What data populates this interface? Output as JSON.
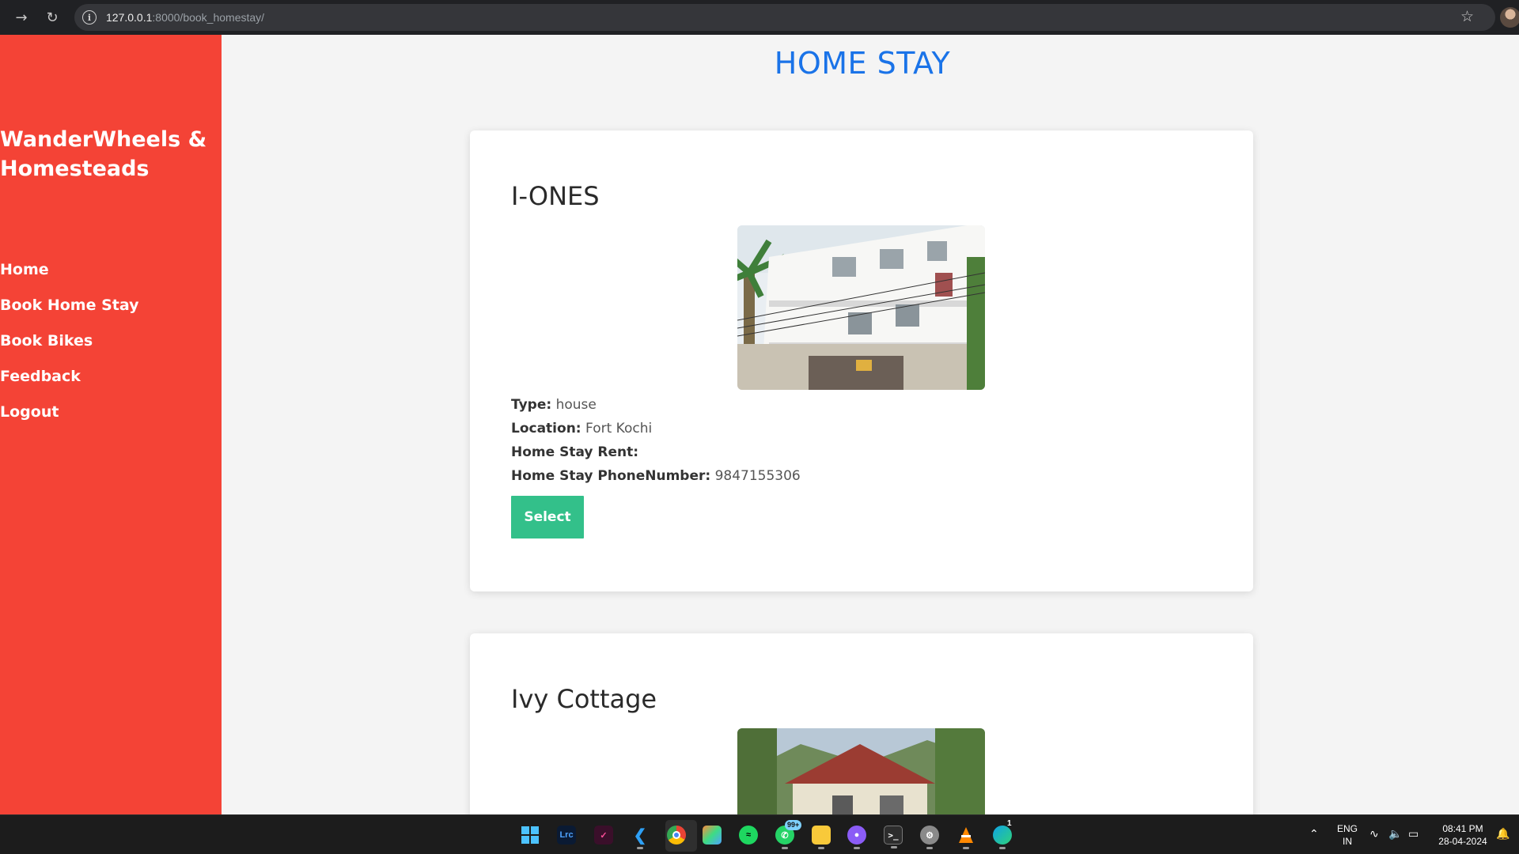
{
  "browser": {
    "url_host": "127.0.0.1",
    "url_path": ":8000/book_homestay/",
    "forward_icon": "arrow-right-icon",
    "reload_icon": "reload-icon",
    "info_icon": "info-icon",
    "bookmark_icon": "star-icon"
  },
  "sidebar": {
    "brand": "WanderWheels & Homesteads",
    "items": [
      {
        "label": "Home"
      },
      {
        "label": "Book Home Stay"
      },
      {
        "label": "Book Bikes"
      },
      {
        "label": "Feedback"
      },
      {
        "label": "Logout"
      }
    ],
    "color": "#f44336"
  },
  "main": {
    "title": "HOME STAY",
    "title_color": "#1a73e8",
    "homestays": [
      {
        "name": "I-ONES",
        "type_label": "Type:",
        "type": "house",
        "location_label": "Location:",
        "location": "Fort Kochi",
        "rent_label": "Home Stay Rent:",
        "rent": "",
        "phone_label": "Home Stay PhoneNumber:",
        "phone": "9847155306",
        "button_label": "Select"
      },
      {
        "name": "Ivy Cottage"
      }
    ],
    "button_color": "#33c08a"
  },
  "taskbar": {
    "whatsapp_badge": "99+",
    "edge_badge": "1",
    "lang_line1": "ENG",
    "lang_line2": "IN",
    "time": "08:41 PM",
    "date": "28-04-2024"
  }
}
